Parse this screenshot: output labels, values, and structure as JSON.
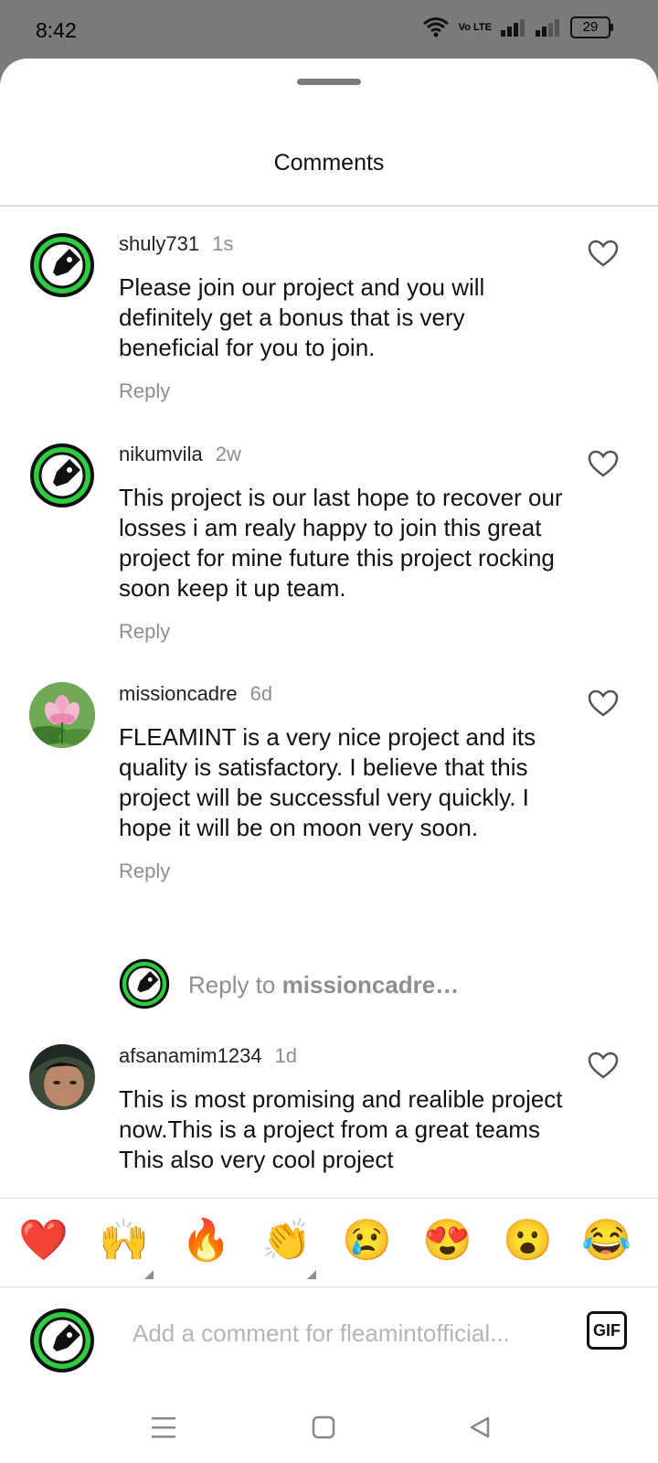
{
  "status_bar": {
    "time": "8:42",
    "battery": "29",
    "volte": "Vo LTE"
  },
  "sheet": {
    "title": "Comments"
  },
  "comments": [
    {
      "username": "shuly731",
      "time": "1s",
      "text": "Please join our project and you will definitely get a bonus that is very beneficial for you to join.",
      "reply_label": "Reply"
    },
    {
      "username": "nikumvila",
      "time": "2w",
      "text": "This project is our last hope to recover our losses i am realy happy to join this great project for mine future this project rocking soon keep it up team.",
      "reply_label": "Reply"
    },
    {
      "username": "missioncadre",
      "time": "6d",
      "text": "FLEAMINT is a very nice project and its quality is satisfactory. I believe that this project will be successful very quickly. I hope it will be on moon very soon.",
      "reply_label": "Reply"
    },
    {
      "username": "afsanamim1234",
      "time": "1d",
      "text": "This is most promising and realible project now.This is a project from a great teams This also very cool project"
    }
  ],
  "reply_prompt": {
    "prefix": "Reply to ",
    "target": "missioncadre…"
  },
  "emoji_bar": [
    {
      "glyph": "❤️",
      "name": "red-heart"
    },
    {
      "glyph": "🙌",
      "name": "raising-hands"
    },
    {
      "glyph": "🔥",
      "name": "fire"
    },
    {
      "glyph": "👏",
      "name": "clapping-hands"
    },
    {
      "glyph": "😢",
      "name": "crying-face"
    },
    {
      "glyph": "😍",
      "name": "heart-eyes"
    },
    {
      "glyph": "😮",
      "name": "surprised-face"
    },
    {
      "glyph": "😂",
      "name": "tears-of-joy"
    }
  ],
  "composer": {
    "placeholder": "Add a comment for fleamintofficial...",
    "gif_label": "GIF"
  },
  "colors": {
    "accent_green": "#2ecc40",
    "muted_text": "#8e8e8e",
    "placeholder": "#b5b5b5"
  },
  "icons": [
    "wifi-icon",
    "signal-icon",
    "battery-icon",
    "heart-outline-icon",
    "menu-icon",
    "home-square-icon",
    "back-triangle-icon",
    "rocket-logo-icon"
  ]
}
